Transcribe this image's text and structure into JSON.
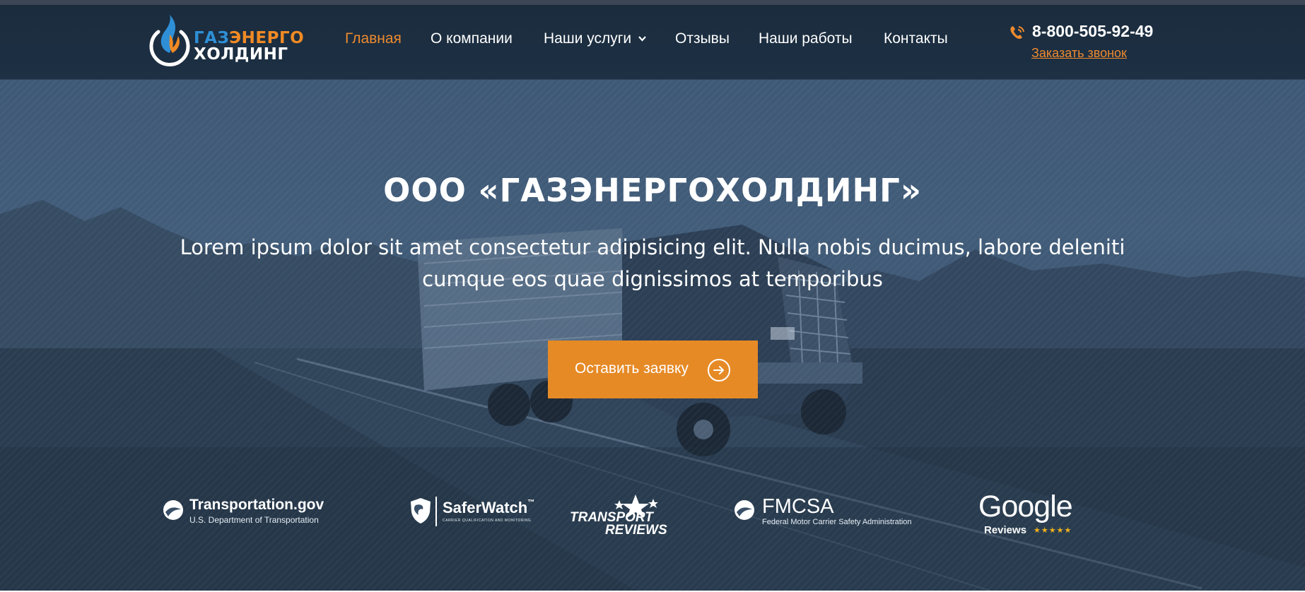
{
  "header": {
    "logo": {
      "line1_part1": "ГАЗ",
      "line1_part2": "ЭНЕРГО",
      "line2": "ХОЛДИНГ"
    },
    "nav": [
      {
        "label": "Главная",
        "active": true
      },
      {
        "label": "О компании"
      },
      {
        "label": "Наши услуги",
        "has_dropdown": true
      },
      {
        "label": "Отзывы"
      },
      {
        "label": "Наши работы"
      },
      {
        "label": "Контакты"
      }
    ],
    "phone": "8-800-505-92-49",
    "callback_label": "Заказать звонок"
  },
  "hero": {
    "title": "ООО «ГАЗЭНЕРГОХОЛДИНГ»",
    "subtitle_line1": "Lorem ipsum dolor sit amet consectetur adipisicing elit. Nulla nobis ducimus, labore deleniti",
    "subtitle_line2": "cumque eos quae dignissimos at temporibus",
    "cta_label": "Оставить заявку"
  },
  "partners": {
    "transportation": {
      "title": "Transportation.gov",
      "sub": "U.S. Department of Transportation"
    },
    "saferwatch": {
      "title": "SaferWatch",
      "tm": "™",
      "sub": "CARRIER QUALIFICATION AND MONITORING"
    },
    "transport_reviews": {
      "line1": "TRANSPORT",
      "line2": "REVIEWS"
    },
    "fmcsa": {
      "title": "FMCSA",
      "sub": "Federal Motor Carrier Safety Administration"
    },
    "google": {
      "title": "Google",
      "sub": "Reviews",
      "stars": "★★★★★"
    }
  },
  "colors": {
    "accent": "#e68a26",
    "header_bg": "#1b2c3d",
    "logo_blue": "#2f8fd6",
    "logo_orange": "#f08a24"
  }
}
